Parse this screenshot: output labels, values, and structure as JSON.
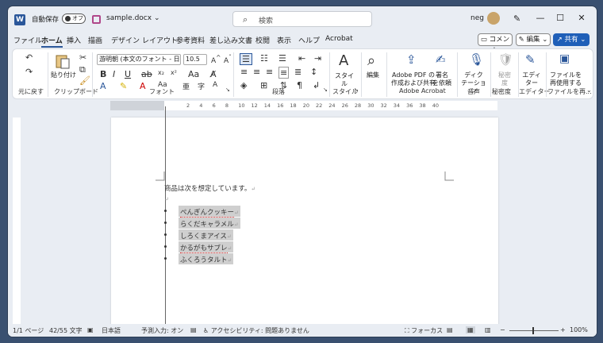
{
  "titlebar": {
    "autosave_label": "自動保存",
    "autosave_state": "オフ",
    "filename": "sample.docx",
    "search_placeholder": "検索",
    "user_name": "neg",
    "minimize": "—",
    "maximize": "☐",
    "close": "✕"
  },
  "menu": {
    "tabs": [
      "ファイル",
      "ホーム",
      "挿入",
      "描画",
      "デザイン",
      "レイアウト",
      "参考資料",
      "差し込み文書",
      "校閲",
      "表示",
      "ヘルプ",
      "Acrobat"
    ],
    "comment": "コメント",
    "edit": "編集",
    "share": "共有"
  },
  "ribbon": {
    "undo_group": "元に戻す",
    "clipboard": {
      "label": "クリップボード",
      "paste": "貼り付け"
    },
    "font": {
      "label": "フォント",
      "name": "游明朝 (本文のフォント - 日本語)",
      "size": "10.5"
    },
    "paragraph": {
      "label": "段落"
    },
    "style": {
      "label": "スタイル",
      "style_btn": "スタイル"
    },
    "edit_group": {
      "label": "編集"
    },
    "acrobat": {
      "label": "Adobe Acrobat",
      "btn1_line1": "Adobe PDF の",
      "btn1_line2": "作成および共有",
      "btn2_line1": "署名",
      "btn2_line2": "を依頼"
    },
    "voice": {
      "label": "音声",
      "btn_line1": "ディク",
      "btn_line2": "テーション"
    },
    "sensitivity": {
      "label": "秘密度",
      "btn_line1": "秘密",
      "btn_line2": "度"
    },
    "editor": {
      "label": "エディター",
      "btn_line1": "エディ",
      "btn_line2": "ター"
    },
    "reuse": {
      "label": "ファイルを再...",
      "btn_line1": "ファイルを",
      "btn_line2": "再使用する"
    }
  },
  "ruler": {
    "numbers": [
      "2",
      "4",
      "6",
      "8",
      "10",
      "12",
      "14",
      "16",
      "18",
      "20",
      "22",
      "24",
      "26",
      "28",
      "30",
      "32",
      "34",
      "36",
      "38",
      "40"
    ]
  },
  "document": {
    "intro": "商品は次を想定しています。",
    "paragraph_mark": "↵",
    "items": [
      "ぺんぎんクッキー",
      "らくだキャラメル",
      "しろくまアイス",
      "かるがもサブレ",
      "ふくろうタルト"
    ]
  },
  "status": {
    "page": "1/1 ページ",
    "words": "42/55 文字",
    "language": "日本語",
    "predict": "予測入力: オン",
    "accessibility": "アクセシビリティ: 問題ありません",
    "focus": "フォーカス",
    "zoom": "100%"
  },
  "colors": {
    "accent": "#2b579a",
    "share": "#1f5fb8",
    "highlight": "#cfcfcf"
  }
}
